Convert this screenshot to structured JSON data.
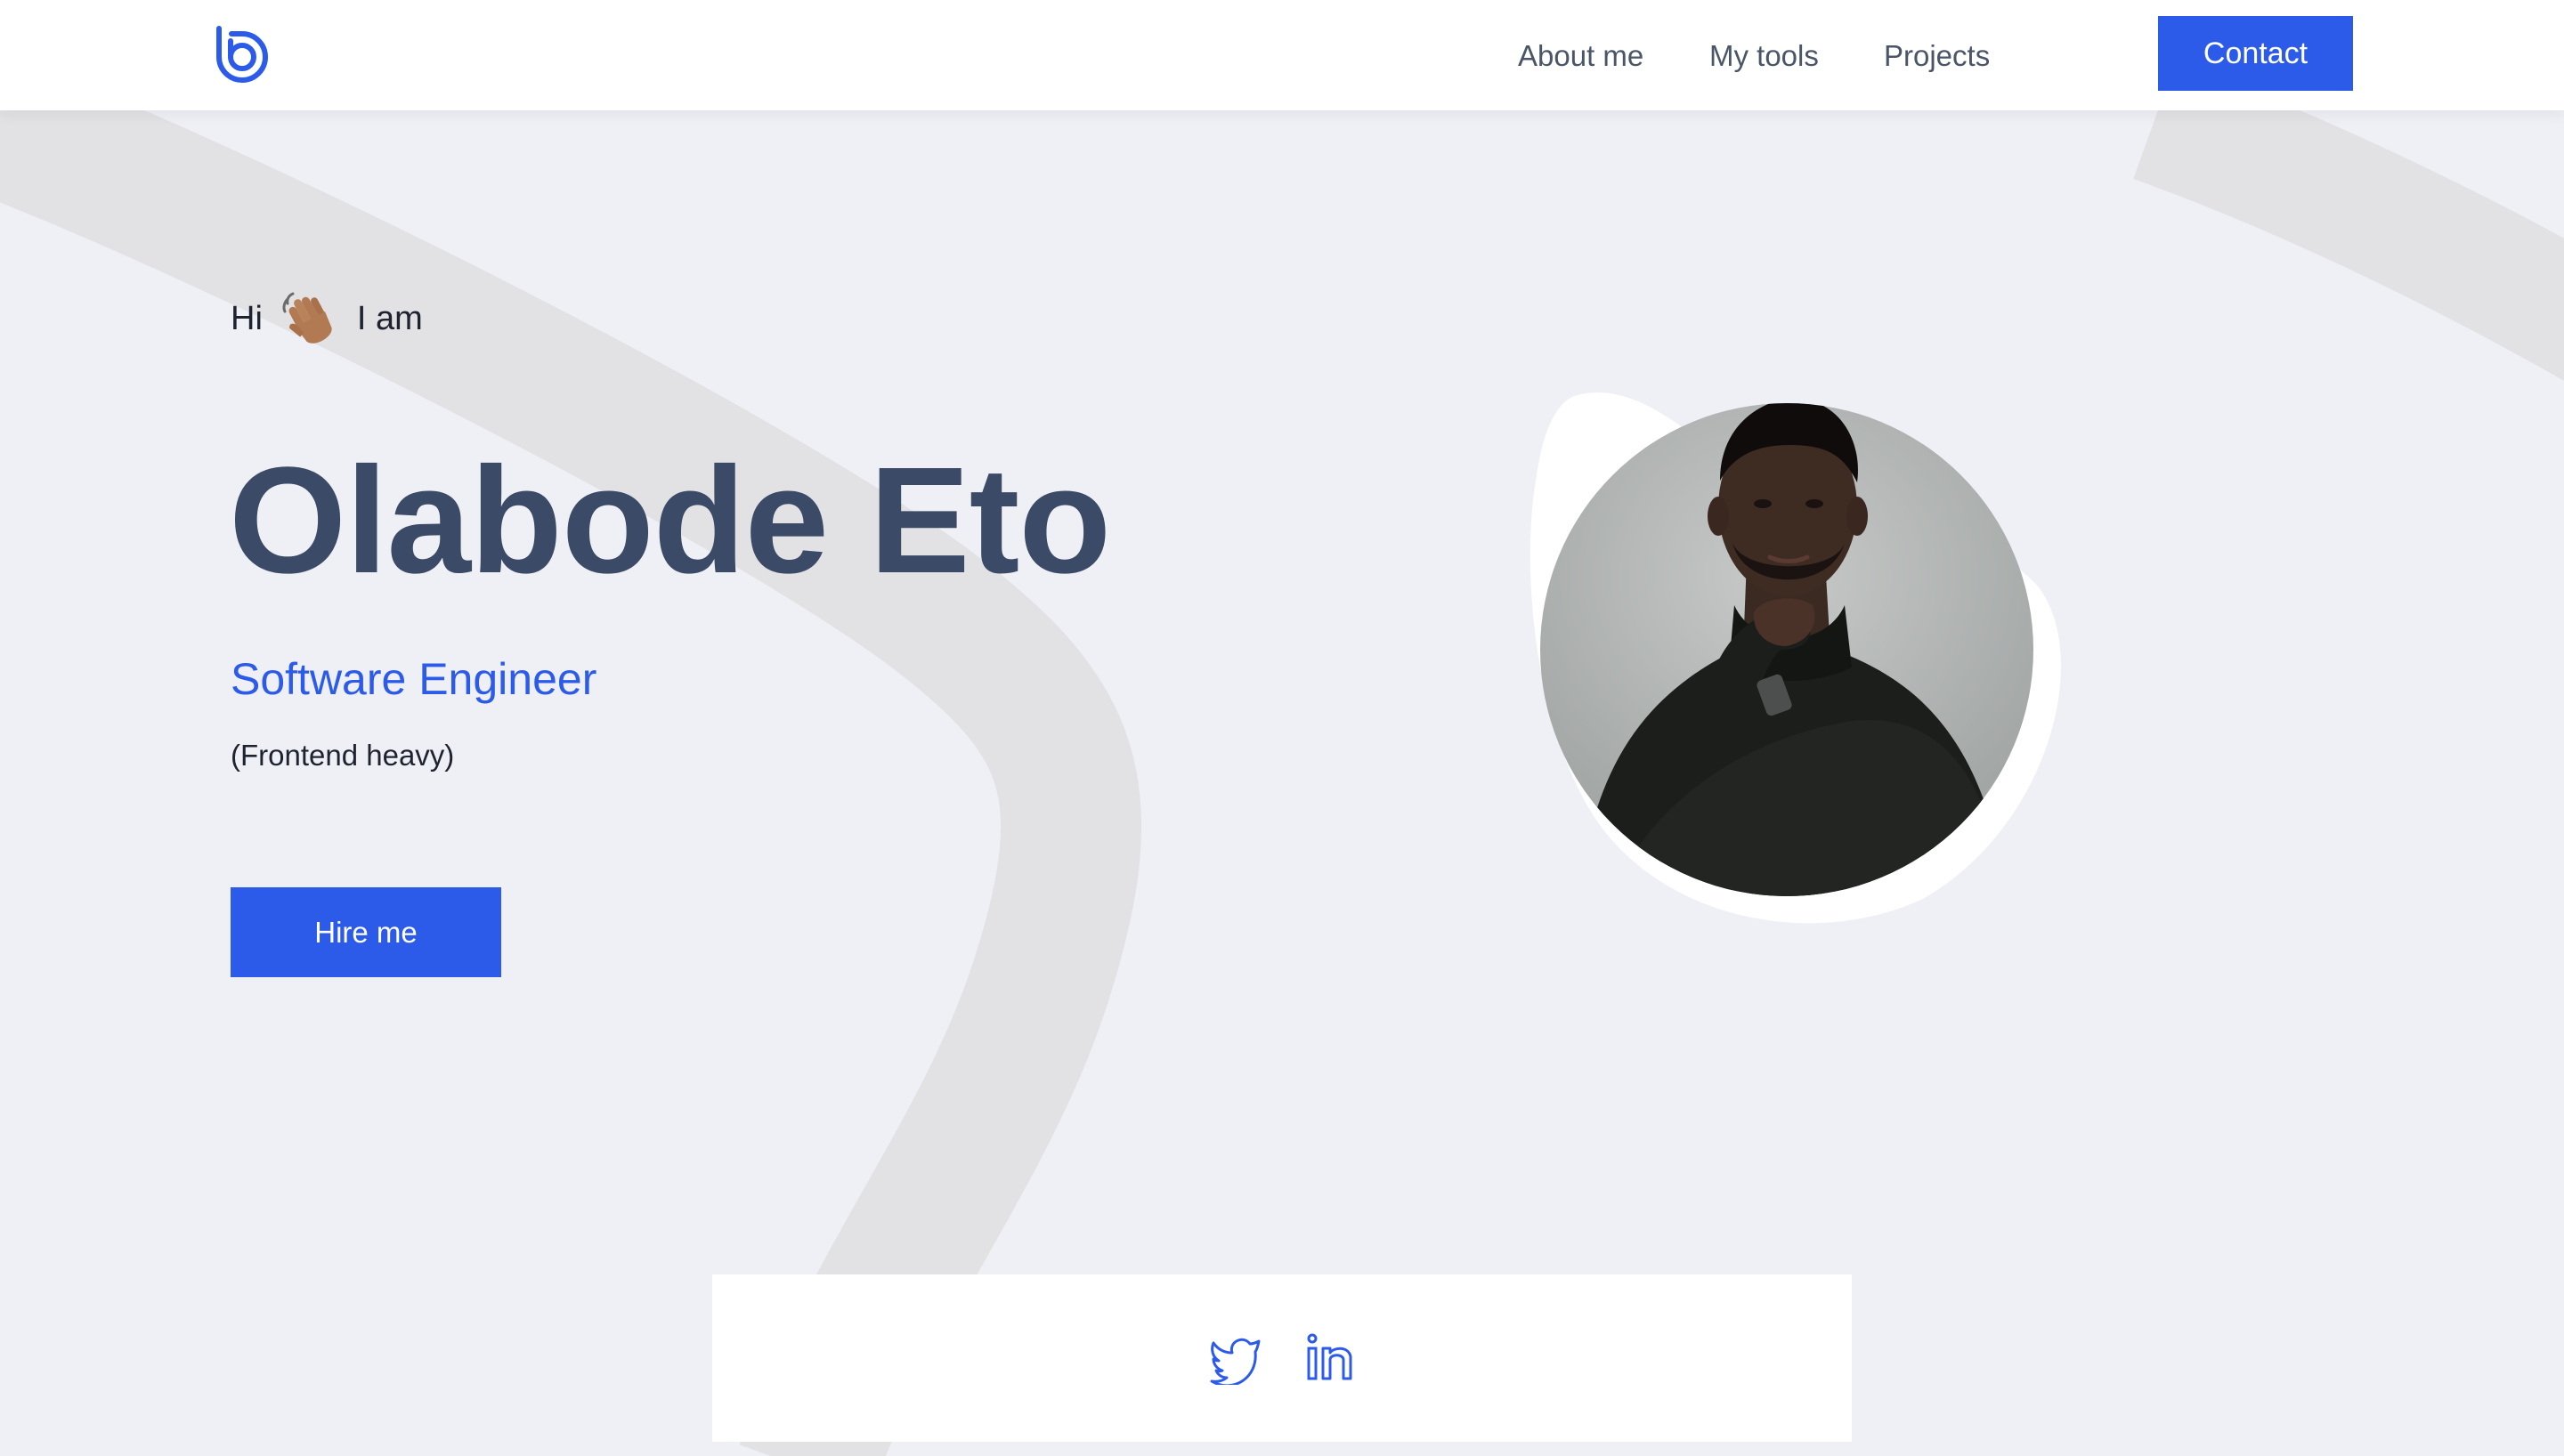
{
  "header": {
    "logo_icon": "b-logo-icon",
    "nav": [
      {
        "label": "About me"
      },
      {
        "label": "My tools"
      },
      {
        "label": "Projects"
      }
    ],
    "contact_label": "Contact"
  },
  "hero": {
    "greeting_prefix": "Hi",
    "greeting_icon": "waving-hand-icon",
    "greeting_suffix": "I am",
    "name": "Olabode Eto",
    "role": "Software Engineer",
    "subtitle": "(Frontend heavy)",
    "hire_label": "Hire me",
    "portrait": "profile-photo"
  },
  "social": {
    "icons": [
      "twitter-icon",
      "linkedin-icon"
    ]
  },
  "colors": {
    "accent": "#2c5ae9",
    "name": "#3b4a66",
    "background": "#eff0f5",
    "card": "#ffffff"
  }
}
